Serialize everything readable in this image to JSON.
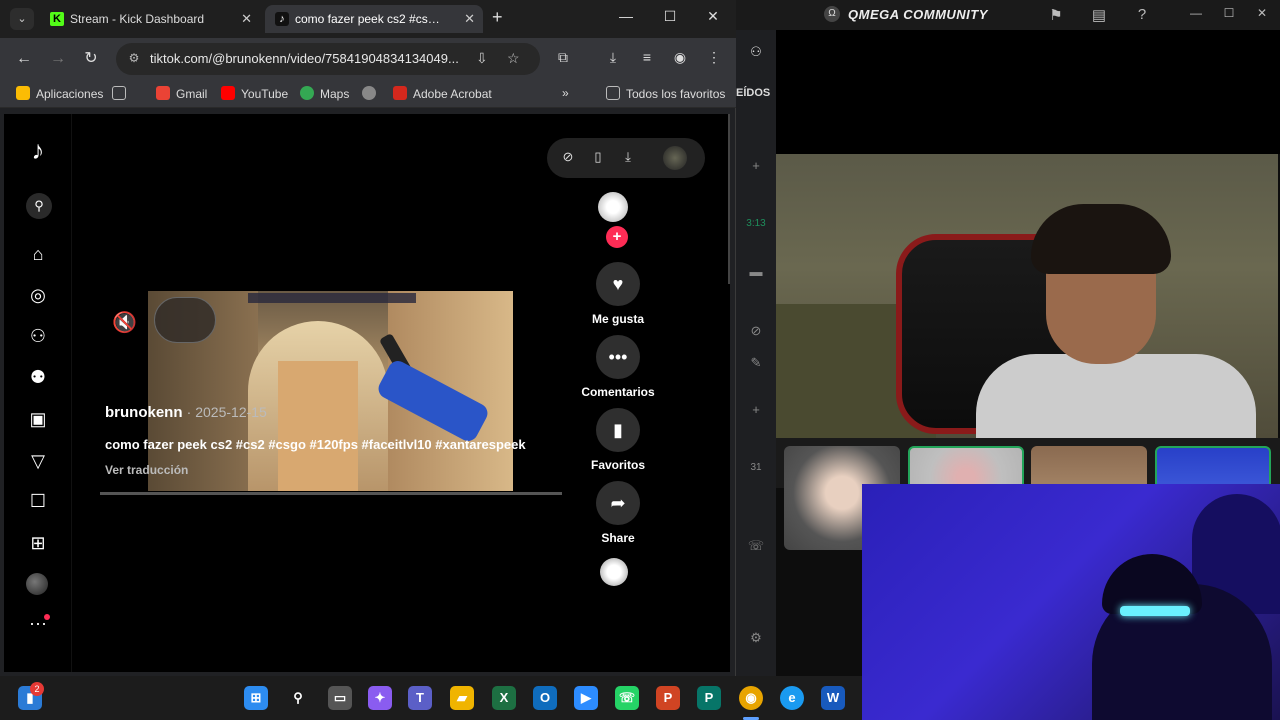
{
  "browser": {
    "tabs": [
      {
        "title": "Stream - Kick Dashboard",
        "favicon": "kick-icon"
      },
      {
        "title": "como fazer peek cs2 #cs2 #csgo",
        "favicon": "tiktok-icon"
      }
    ],
    "url": "tiktok.com/@brunokenn/video/75841904834134049...",
    "bookmarks": [
      {
        "label": "Aplicaciones"
      },
      {
        "label": "Gmail"
      },
      {
        "label": "YouTube"
      },
      {
        "label": "Maps"
      },
      {
        "label": "Adobe Acrobat"
      },
      {
        "label": "Todos los favoritos"
      }
    ]
  },
  "tiktok": {
    "username": "brunokenn",
    "date": "· 2025-12-15",
    "caption": "como fazer peek cs2 #cs2 #csgo #120fps #faceitlvl10 #xantarespeek",
    "translate": "Ver traducción",
    "actions": {
      "like": "Me gusta",
      "comments": "Comentarios",
      "favorites": "Favoritos",
      "share": "Share"
    }
  },
  "discord": {
    "label": "EÍDOS",
    "time": "3:13",
    "count": "31"
  },
  "obs": {
    "title": "QMEGA COMMUNITY"
  },
  "taskbar": {
    "badge": "2"
  },
  "colors": {
    "tiktok_red": "#fe2c55",
    "kick_green": "#53fc18",
    "discord_green": "#23a55a"
  }
}
